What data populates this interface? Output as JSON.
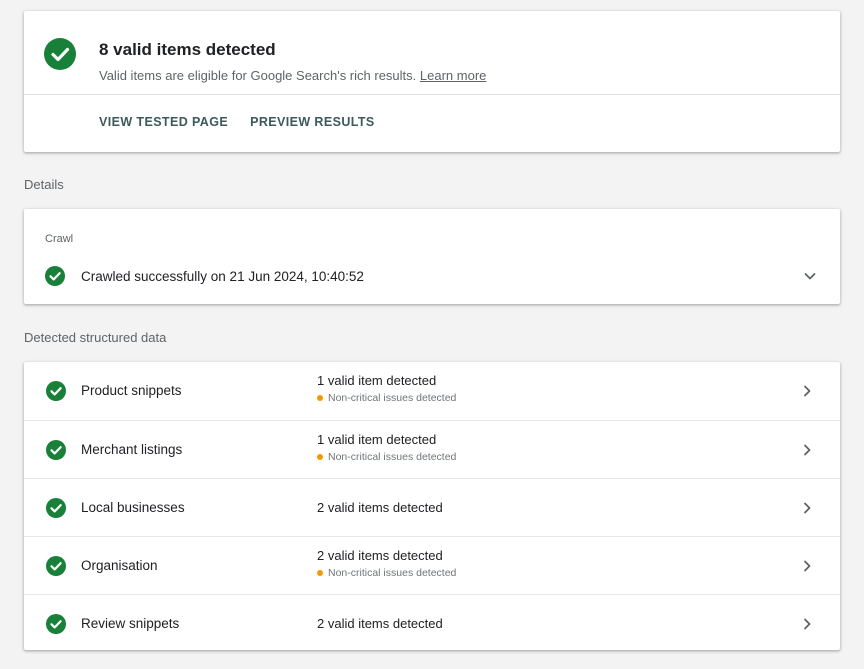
{
  "summary": {
    "title": "8 valid items detected",
    "subtitle": "Valid items are eligible for Google Search's rich results.",
    "learn_more": "Learn more",
    "view_tested_page": "VIEW TESTED PAGE",
    "preview_results": "PREVIEW RESULTS"
  },
  "details_label": "Details",
  "crawl": {
    "heading": "Crawl",
    "status": "Crawled successfully on 21 Jun 2024, 10:40:52"
  },
  "detected_label": "Detected structured data",
  "items": [
    {
      "name": "Product snippets",
      "status": "1 valid item detected",
      "warning": "Non-critical issues detected"
    },
    {
      "name": "Merchant listings",
      "status": "1 valid item detected",
      "warning": "Non-critical issues detected"
    },
    {
      "name": "Local businesses",
      "status": "2 valid items detected",
      "warning": null
    },
    {
      "name": "Organisation",
      "status": "2 valid items detected",
      "warning": "Non-critical issues detected"
    },
    {
      "name": "Review snippets",
      "status": "2 valid items detected",
      "warning": null
    }
  ],
  "icons": {
    "check": "check-circle-icon",
    "expand": "chevron-down-icon",
    "open": "chevron-right-icon"
  },
  "colors": {
    "success": "#188038",
    "warning": "#f29900",
    "action_text": "#3c5a5a"
  }
}
